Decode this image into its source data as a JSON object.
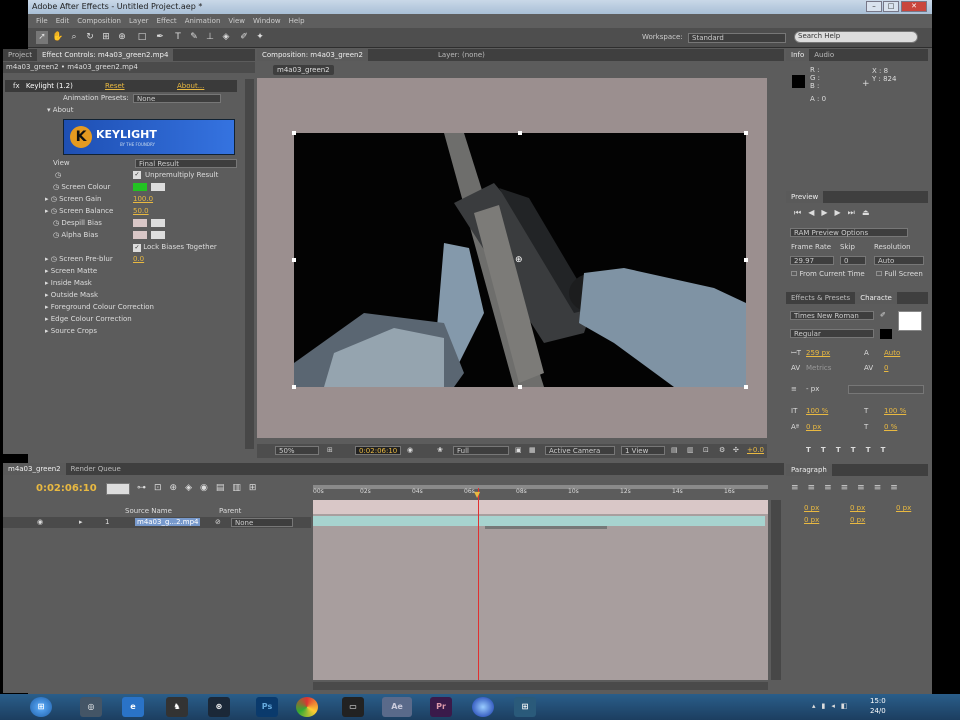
{
  "window": {
    "title": "Adobe After Effects - Untitled Project.aep *"
  },
  "menu": [
    "File",
    "Edit",
    "Composition",
    "Layer",
    "Effect",
    "Animation",
    "View",
    "Window",
    "Help"
  ],
  "toolbar": {
    "workspace_label": "Workspace:",
    "workspace_value": "Standard",
    "search_placeholder": "Search Help"
  },
  "effect_controls": {
    "tab_project": "Project",
    "tab_effects": "Effect Controls: m4a03_green2.mp4",
    "crumb": "m4a03_green2 • m4a03_green2.mp4",
    "effect_name": "Keylight (1.2)",
    "reset": "Reset",
    "about_link": "About...",
    "anim_presets_label": "Animation Presets:",
    "anim_presets_value": "None",
    "about": "About",
    "logo_text": "KEYLIGHT",
    "logo_sub": "BY THE FOUNDRY",
    "view_label": "View",
    "view_value": "Final Result",
    "unpremultiply": "Unpremultiply Result",
    "screen_colour": "Screen Colour",
    "screen_gain": "Screen Gain",
    "screen_gain_value": "100.0",
    "screen_balance": "Screen Balance",
    "screen_balance_value": "50.0",
    "despill_bias": "Despill Bias",
    "alpha_bias": "Alpha Bias",
    "lock_biases": "Lock Biases Together",
    "screen_preblur": "Screen Pre-blur",
    "screen_preblur_value": "0.0",
    "groups": [
      "Screen Matte",
      "Inside Mask",
      "Outside Mask",
      "Foreground Colour Correction",
      "Edge Colour Correction",
      "Source Crops"
    ],
    "screen_colour_hex": "#22c322"
  },
  "comp": {
    "tab": "Composition: m4a03_green2",
    "layer_tab": "Layer: (none)",
    "comp_name": "m4a03_green2",
    "zoom": "50%",
    "timecode": "0:02:06:10",
    "resolution": "Full",
    "camera": "Active Camera",
    "views": "1 View",
    "exposure": "+0.0"
  },
  "info": {
    "tab": "Info",
    "audio_tab": "Audio",
    "r": "R :",
    "g": "G :",
    "b": "B :",
    "a": "A : 0",
    "x": "X : 8",
    "y": "Y : 824"
  },
  "preview": {
    "tab": "Preview",
    "ram": "RAM Preview Options",
    "frame_rate_label": "Frame Rate",
    "skip_label": "Skip",
    "resolution_label": "Resolution",
    "frame_rate": "29.97",
    "skip": "0",
    "resolution": "Auto",
    "from_current": "From Current Time",
    "full_screen": "Full Screen"
  },
  "character": {
    "tab_effects": "Effects & Presets",
    "tab_char": "Characte",
    "font": "Times New Roman",
    "style": "Regular",
    "size": "259 px",
    "leading": "Auto",
    "kerning": "Metrics",
    "tracking": "0",
    "stroke": "- px",
    "vscale": "100 %",
    "hscale": "100 %",
    "baseline": "0 px",
    "tsume": "0 %"
  },
  "paragraph": {
    "tab": "Paragraph",
    "i1": "0 px",
    "i2": "0 px",
    "i3": "0 px",
    "i4": "0 px",
    "i5": "0 px"
  },
  "timeline": {
    "tab_comp": "m4a03_green2",
    "tab_render": "Render Queue",
    "timecode": "0:02:06:10",
    "col_source": "Source Name",
    "col_parent": "Parent",
    "layer_num": "1",
    "layer_name": "m4a03_g...2.mp4",
    "layer_parent": "None",
    "ticks": [
      "00s",
      "02s",
      "04s",
      "06s",
      "08s",
      "10s",
      "12s",
      "14s",
      "16s"
    ]
  },
  "taskbar": {
    "time": "15:0",
    "date": "24/0"
  }
}
